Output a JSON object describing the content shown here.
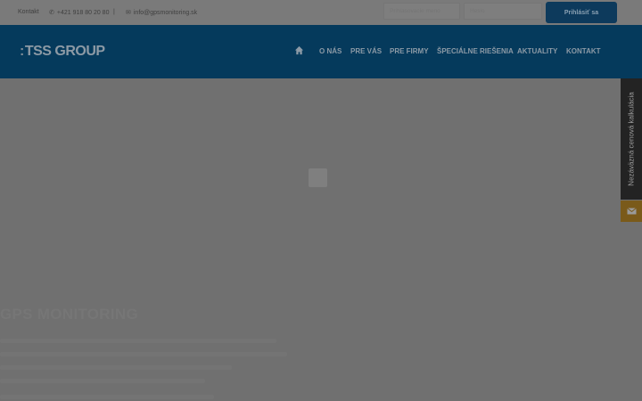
{
  "topbar": {
    "contact_label": "Kontakt",
    "phone": "+421 918 80 20 80",
    "separator": "|",
    "email": "info@gpsmonitoring.sk",
    "username_placeholder": "Prihlasovacie meno",
    "password_placeholder": "Heslo",
    "login_button": "Prihlásiť sa"
  },
  "header": {
    "logo_text": "TSS GROUP",
    "nav": [
      "O NÁS",
      "PRE VÁS",
      "PRE FIRMY",
      "ŠPECIÁLNE RIEŠENIA",
      "AKTUALITY",
      "KONTAKT"
    ]
  },
  "hero": {
    "title": "GPS MONITORING"
  },
  "side": {
    "calc_label": "Nezáväzná cenová kalkulácia"
  },
  "icons": {
    "phone": "phone-icon",
    "email": "envelope-icon",
    "home": "home-icon",
    "mail": "envelope-icon"
  },
  "colors": {
    "header_bg": "#053a5c",
    "login_button": "#0d3a5c",
    "side_mail": "#7a5a1a"
  }
}
